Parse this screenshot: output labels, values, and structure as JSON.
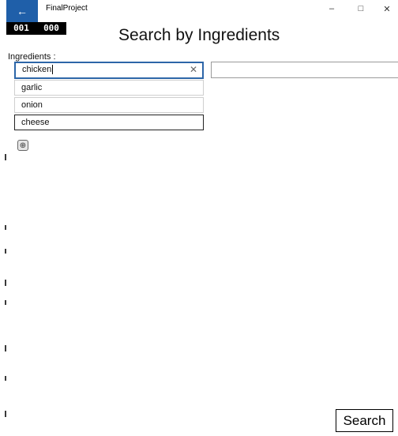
{
  "titlebar": {
    "back_icon": "←",
    "app_title": "FinalProject",
    "minimize_icon": "–",
    "maximize_icon": "□",
    "close_icon": "✕"
  },
  "counter": {
    "left": "001",
    "right": "000"
  },
  "page": {
    "title": "Search by Ingredients"
  },
  "ingredients": {
    "label": "Ingredients :",
    "items": [
      "chicken",
      "garlic",
      "onion",
      "cheese"
    ],
    "clear_icon": "✕",
    "add_icon": "⊕"
  },
  "search_button": {
    "label": "Search"
  },
  "colors": {
    "accent": "#1f5fa9",
    "active_border": "#2d66a8",
    "counter_bg": "#000000"
  }
}
